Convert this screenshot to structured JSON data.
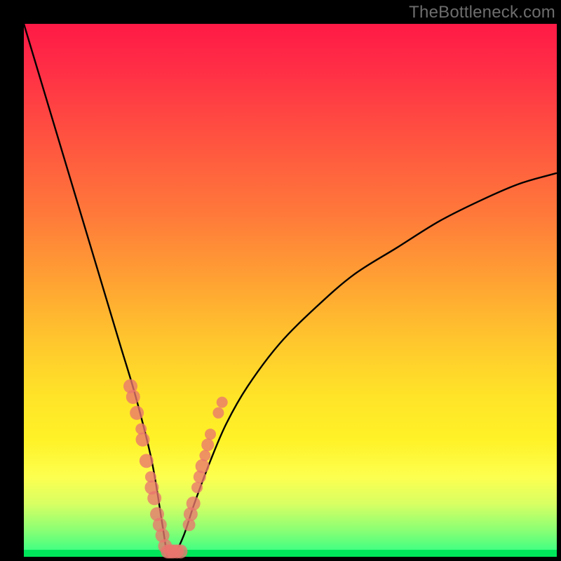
{
  "watermark": "TheBottleneck.com",
  "colors": {
    "dot": "#e9766e",
    "curve": "#000000",
    "gradient_top": "#ff1a46",
    "gradient_bottom": "#00e65a"
  },
  "chart_data": {
    "type": "line",
    "title": "",
    "xlabel": "",
    "ylabel": "",
    "xlim": [
      0,
      100
    ],
    "ylim": [
      0,
      100
    ],
    "note": "Axes are unlabeled in the source image; x and y are normalized 0–100. Curve is a V-shaped bottleneck curve with minimum near x≈27, y≈0. Left branch rises steeply to y≈100 at x≈0; right branch rises with decreasing slope to y≈72 at x≈100.",
    "series": [
      {
        "name": "bottleneck-curve",
        "x": [
          0,
          3,
          6,
          9,
          12,
          15,
          18,
          21,
          24,
          26,
          27,
          28,
          30,
          32,
          35,
          38,
          42,
          48,
          55,
          62,
          70,
          78,
          86,
          93,
          100
        ],
        "y": [
          100,
          90,
          80,
          70,
          60,
          50,
          40,
          30,
          18,
          6,
          0,
          0,
          4,
          10,
          18,
          25,
          32,
          40,
          47,
          53,
          58,
          63,
          67,
          70,
          72
        ]
      }
    ],
    "scatter": [
      {
        "name": "left-branch-dots",
        "points": [
          {
            "x": 20.0,
            "y": 32,
            "r": 10
          },
          {
            "x": 20.5,
            "y": 30,
            "r": 10
          },
          {
            "x": 21.2,
            "y": 27,
            "r": 10
          },
          {
            "x": 22.0,
            "y": 24,
            "r": 8
          },
          {
            "x": 22.3,
            "y": 22,
            "r": 10
          },
          {
            "x": 23.0,
            "y": 18,
            "r": 10
          },
          {
            "x": 23.8,
            "y": 15,
            "r": 8
          },
          {
            "x": 24.0,
            "y": 13,
            "r": 10
          },
          {
            "x": 24.5,
            "y": 11,
            "r": 10
          },
          {
            "x": 25.0,
            "y": 8,
            "r": 10
          },
          {
            "x": 25.5,
            "y": 6,
            "r": 10
          },
          {
            "x": 26.0,
            "y": 4,
            "r": 10
          },
          {
            "x": 26.5,
            "y": 2,
            "r": 10
          },
          {
            "x": 27.0,
            "y": 1,
            "r": 10
          },
          {
            "x": 27.5,
            "y": 1,
            "r": 10
          },
          {
            "x": 28.0,
            "y": 1,
            "r": 10
          },
          {
            "x": 28.7,
            "y": 1,
            "r": 10
          },
          {
            "x": 29.4,
            "y": 1,
            "r": 10
          }
        ]
      },
      {
        "name": "right-branch-dots",
        "points": [
          {
            "x": 31.0,
            "y": 6,
            "r": 9
          },
          {
            "x": 31.3,
            "y": 8,
            "r": 10
          },
          {
            "x": 31.8,
            "y": 10,
            "r": 10
          },
          {
            "x": 32.5,
            "y": 13,
            "r": 8
          },
          {
            "x": 33.0,
            "y": 15,
            "r": 9
          },
          {
            "x": 33.5,
            "y": 17,
            "r": 10
          },
          {
            "x": 34.0,
            "y": 19,
            "r": 8
          },
          {
            "x": 34.5,
            "y": 21,
            "r": 9
          },
          {
            "x": 35.0,
            "y": 23,
            "r": 8
          },
          {
            "x": 36.5,
            "y": 27,
            "r": 8
          },
          {
            "x": 37.2,
            "y": 29,
            "r": 8
          }
        ]
      }
    ]
  }
}
